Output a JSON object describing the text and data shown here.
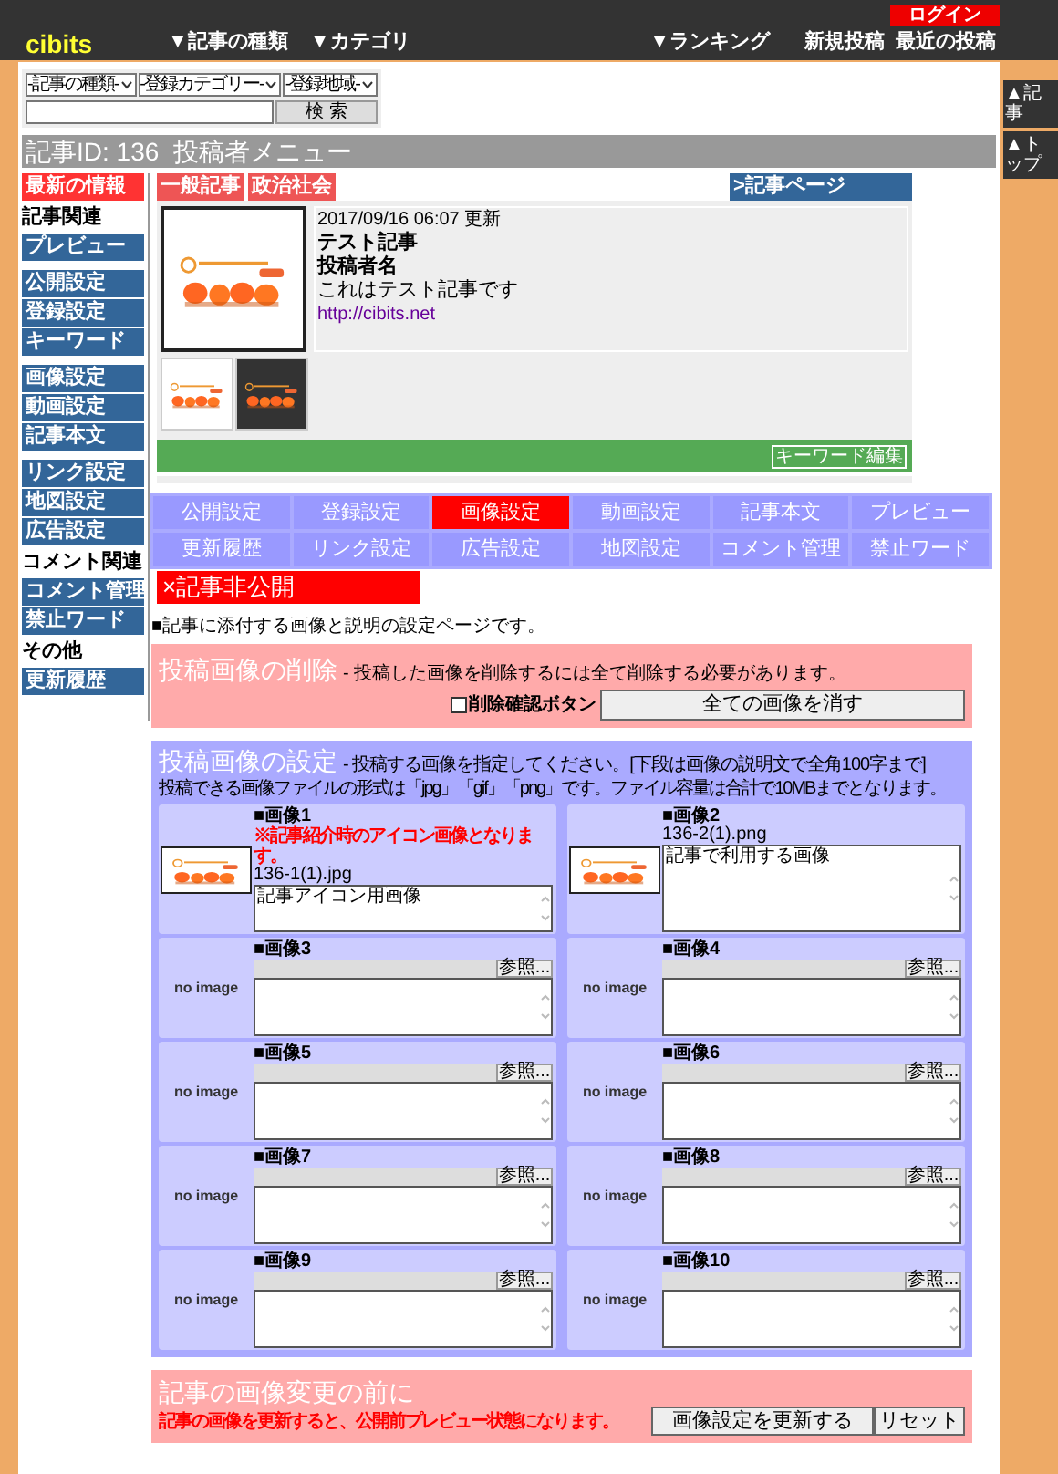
{
  "header": {
    "logo": "cibits",
    "nav": [
      "▼記事の種類",
      "▼カテゴリ",
      "▼ランキング"
    ],
    "links": [
      "新規投稿",
      "最近の投稿"
    ],
    "login": "ログイン"
  },
  "side_buttons": [
    "▲記事",
    "▲トップ"
  ],
  "search": {
    "selects": [
      "-記事の種類-",
      "-登録カテゴリー-",
      "-登録地域-"
    ],
    "button": "検 索"
  },
  "title_bar": "記事ID: 136  投稿者メニュー",
  "sidebar": {
    "groups": [
      [
        {
          "label": "最新の情報",
          "kind": "link",
          "selected": true
        },
        {
          "label": "記事関連",
          "kind": "section"
        },
        {
          "label": "プレビュー",
          "kind": "link",
          "selected": false
        }
      ],
      [
        {
          "label": "公開設定",
          "kind": "link",
          "selected": false
        },
        {
          "label": "登録設定",
          "kind": "link",
          "selected": false
        },
        {
          "label": "キーワード",
          "kind": "link",
          "selected": false
        }
      ],
      [
        {
          "label": "画像設定",
          "kind": "link",
          "selected": false
        },
        {
          "label": "動画設定",
          "kind": "link",
          "selected": false
        },
        {
          "label": "記事本文",
          "kind": "link",
          "selected": false
        }
      ],
      [
        {
          "label": "リンク設定",
          "kind": "link",
          "selected": false
        },
        {
          "label": "地図設定",
          "kind": "link",
          "selected": false
        },
        {
          "label": "広告設定",
          "kind": "link",
          "selected": false
        },
        {
          "label": "コメント関連",
          "kind": "section"
        },
        {
          "label": "コメント管理",
          "kind": "link",
          "selected": false
        },
        {
          "label": "禁止ワード",
          "kind": "link",
          "selected": false
        },
        {
          "label": "その他",
          "kind": "section"
        },
        {
          "label": "更新履歴",
          "kind": "link",
          "selected": false
        }
      ]
    ]
  },
  "article": {
    "tags": [
      "一般記事",
      "政治社会"
    ],
    "page_link": ">記事ページ",
    "date": "2017/09/16 06:07 更新",
    "title": "テスト記事",
    "author": "投稿者名",
    "summary": "これはテスト記事です",
    "url": "http://cibits.net",
    "thumbnails": [
      {
        "kind": "picture",
        "dark": false
      },
      {
        "kind": "picture",
        "dark": true
      }
    ],
    "keyword_button": "キーワード編集"
  },
  "tabs": [
    {
      "label": "公開設定",
      "selected": false
    },
    {
      "label": "登録設定",
      "selected": false
    },
    {
      "label": "画像設定",
      "selected": true
    },
    {
      "label": "動画設定",
      "selected": false
    },
    {
      "label": "記事本文",
      "selected": false
    },
    {
      "label": "プレビュー",
      "selected": false
    },
    {
      "label": "更新履歴",
      "selected": false
    },
    {
      "label": "リンク設定",
      "selected": false
    },
    {
      "label": "広告設定",
      "selected": false
    },
    {
      "label": "地図設定",
      "selected": false
    },
    {
      "label": "コメント管理",
      "selected": false
    },
    {
      "label": "禁止ワード",
      "selected": false
    }
  ],
  "status_badge": "×記事非公開",
  "intro": "■記事に添付する画像と説明の設定ページです。",
  "delete_section": {
    "title": "投稿画像の削除",
    "note": "- 投稿した画像を削除するには全て削除する必要があります。",
    "checkbox": {
      "label": "削除確認ボタン",
      "checked": false
    },
    "button": "全ての画像を消す"
  },
  "images_section": {
    "title": "投稿画像の設定",
    "note": "- 投稿する画像を指定してください。[下段は画像の説明文で全角100字まで]",
    "formats": "投稿できる画像ファイルの形式は「jpg」「gif」「png」です。ファイル容量は合計で10MBまでとなります。",
    "images": [
      {
        "kind": "uploaded",
        "label": "■画像1",
        "note": "※記事紹介時のアイコン画像となります。",
        "filename": "136-1(1).jpg",
        "description": "記事アイコン用画像"
      },
      {
        "kind": "uploaded",
        "label": "■画像2",
        "filename": "136-2(1).png",
        "description": "記事で利用する画像"
      },
      {
        "kind": "empty",
        "label": "■画像3",
        "placeholder_image": "no image",
        "browse": "参照..."
      },
      {
        "kind": "empty",
        "label": "■画像4",
        "placeholder_image": "no image",
        "browse": "参照..."
      },
      {
        "kind": "empty",
        "label": "■画像5",
        "placeholder_image": "no image",
        "browse": "参照..."
      },
      {
        "kind": "empty",
        "label": "■画像6",
        "placeholder_image": "no image",
        "browse": "参照..."
      },
      {
        "kind": "empty",
        "label": "■画像7",
        "placeholder_image": "no image",
        "browse": "参照..."
      },
      {
        "kind": "empty",
        "label": "■画像8",
        "placeholder_image": "no image",
        "browse": "参照..."
      },
      {
        "kind": "empty",
        "label": "■画像9",
        "placeholder_image": "no image",
        "browse": "参照..."
      },
      {
        "kind": "empty",
        "label": "■画像10",
        "placeholder_image": "no image",
        "browse": "参照..."
      }
    ]
  },
  "footer": {
    "title": "記事の画像変更の前に",
    "warning": "記事の画像を更新すると、公開前プレビュー状態になります。",
    "buttons": [
      "画像設定を更新する",
      "リセット"
    ]
  }
}
